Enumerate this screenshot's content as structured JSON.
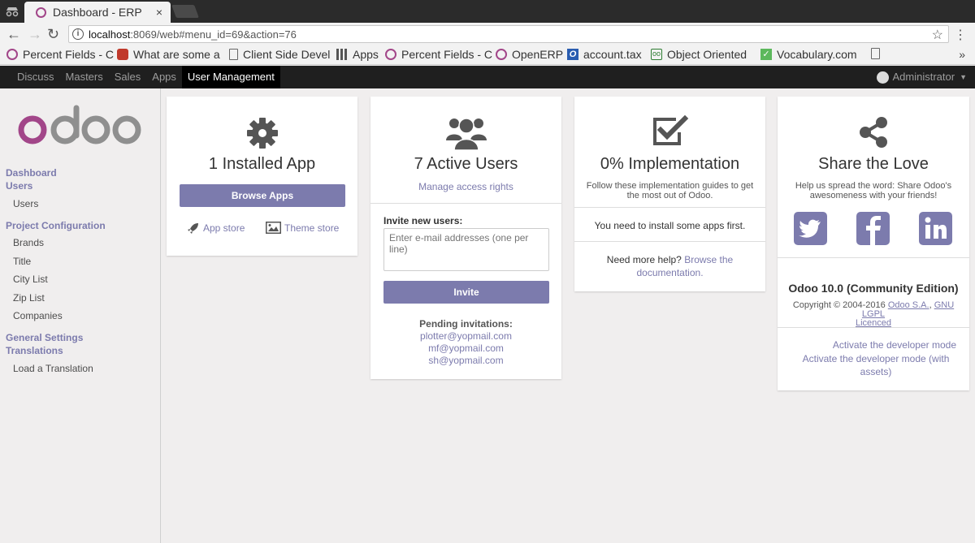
{
  "browser": {
    "tab_title": "Dashboard - ERP",
    "tab_close": "×",
    "url_host": "localhost",
    "url_path": ":8069/web#menu_id=69&action=76",
    "bookmarks": [
      {
        "label": "Percent Fields - C",
        "icon": "odoo-icon"
      },
      {
        "label": "What are some a",
        "icon": "reddit-icon"
      },
      {
        "label": "Client Side Devel",
        "icon": "page-icon"
      },
      {
        "label": "Apps",
        "icon": "apps-grid-icon"
      },
      {
        "label": "Percent Fields - C",
        "icon": "odoo-icon"
      },
      {
        "label": "OpenERP",
        "icon": "odoo-icon"
      },
      {
        "label": "account.tax",
        "icon": "o-icon"
      },
      {
        "label": "Object Oriented",
        "icon": "oo-icon"
      },
      {
        "label": "Vocabulary.com",
        "icon": "vocab-icon"
      }
    ],
    "bookmarks_more": "»"
  },
  "appbar": {
    "menu": [
      "Discuss",
      "Masters",
      "Sales",
      "Apps",
      "User Management"
    ],
    "active_index": 4,
    "user": "Administrator"
  },
  "sidebar": {
    "sections": [
      {
        "label": "Dashboard",
        "items": []
      },
      {
        "label": "Users",
        "items": [
          "Users"
        ]
      },
      {
        "label": "Project Configuration",
        "items": [
          "Brands",
          "Title",
          "City List",
          "Zip List",
          "Companies"
        ]
      },
      {
        "label": "General Settings",
        "items": []
      },
      {
        "label": "Translations",
        "items": [
          "Load a Translation"
        ]
      }
    ]
  },
  "apps_card": {
    "title": "1 Installed App",
    "browse_button": "Browse Apps",
    "app_store": "App store",
    "theme_store": "Theme store"
  },
  "users_card": {
    "title": "7 Active Users",
    "manage_link": "Manage access rights",
    "invite_label": "Invite new users:",
    "invite_placeholder": "Enter e-mail addresses (one per line)",
    "invite_button": "Invite",
    "pending_label": "Pending invitations:",
    "pending": [
      "plotter@yopmail.com",
      "mf@yopmail.com",
      "sh@yopmail.com"
    ]
  },
  "impl_card": {
    "title": "0% Implementation",
    "subtitle": "Follow these implementation guides to get the most out of Odoo.",
    "install_notice": "You need to install some apps first.",
    "help_text": "Need more help?",
    "help_link": "Browse the documentation."
  },
  "share_card": {
    "title": "Share the Love",
    "subtitle": "Help us spread the word: Share Odoo's awesomeness with your friends!",
    "edition": "Odoo 10.0 (Community Edition)",
    "copyright": "Copyright © 2004-2016",
    "odoo_link": "Odoo S.A.",
    "license_link": "GNU LGPL",
    "licenced": "Licenced",
    "dev_mode": "Activate the developer mode",
    "dev_mode_assets": "Activate the developer mode (with assets)"
  },
  "colors": {
    "brand": "#7c7bad",
    "odoo_purple": "#a24689",
    "social": "#7c7bad"
  }
}
